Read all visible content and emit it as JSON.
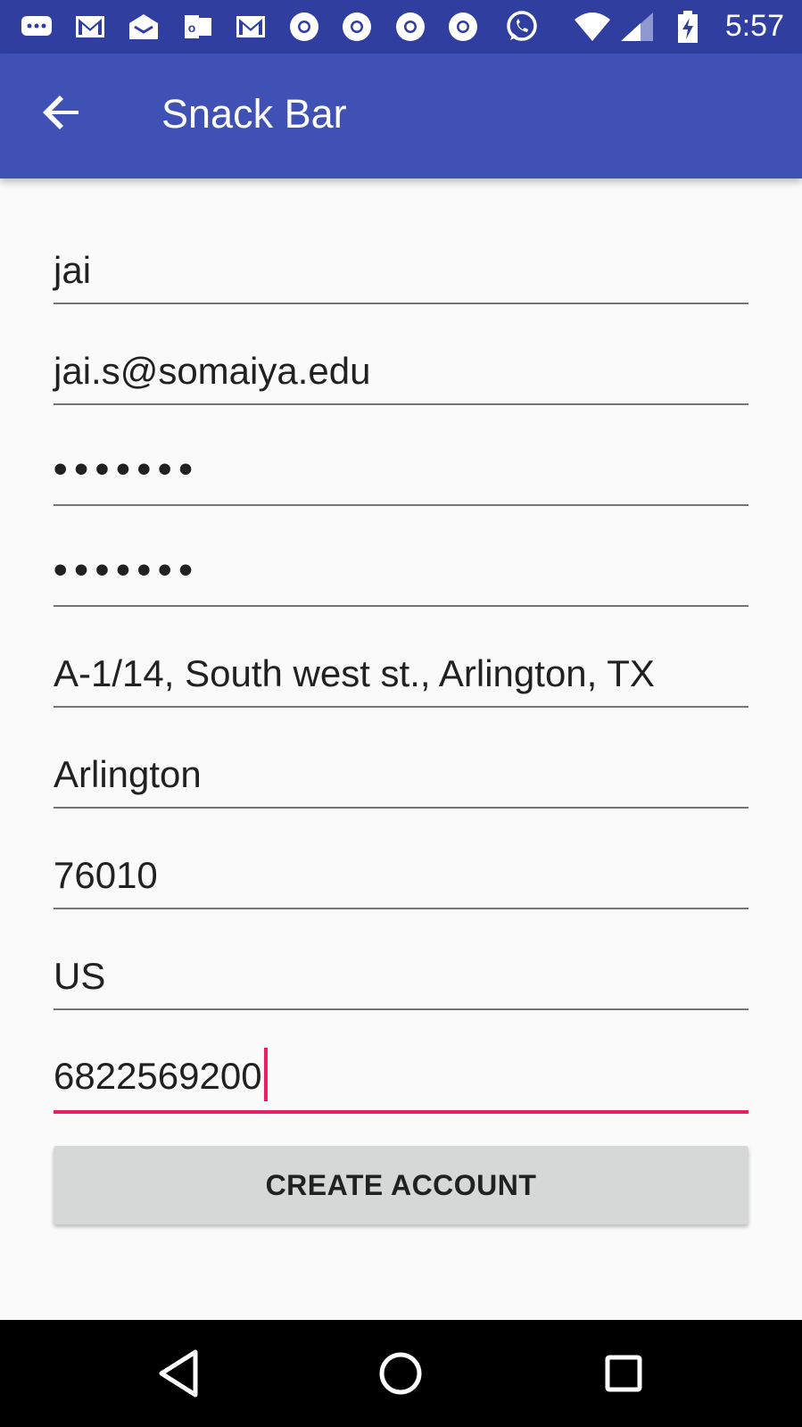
{
  "status_bar": {
    "time": "5:57",
    "icons": [
      "chat-bubble-icon",
      "gmail-icon",
      "inbox-icon",
      "outlook-icon",
      "gmail-icon",
      "chrome-icon",
      "chrome-icon",
      "chrome-icon",
      "chrome-icon",
      "whatsapp-icon",
      "wifi-icon",
      "signal-icon",
      "battery-charging-icon"
    ]
  },
  "app_bar": {
    "title": "Snack Bar",
    "back_icon": "arrow-back-icon"
  },
  "form": {
    "name": "jai",
    "email": "jai.s@somaiya.edu",
    "password": "•••••••",
    "confirm_password": "•••••••",
    "address": "A-1/14, South west st., Arlington, TX",
    "city": "Arlington",
    "zip": "76010",
    "country": "US",
    "phone": "6822569200"
  },
  "create_button_label": "CREATE ACCOUNT",
  "nav_bar": {
    "back_icon": "nav-back-icon",
    "home_icon": "nav-home-icon",
    "recents_icon": "nav-recents-icon"
  },
  "colors": {
    "status_bar": "#303f9f",
    "app_bar": "#3f51b5",
    "accent": "#e91e63",
    "button": "#d6d7d7"
  }
}
